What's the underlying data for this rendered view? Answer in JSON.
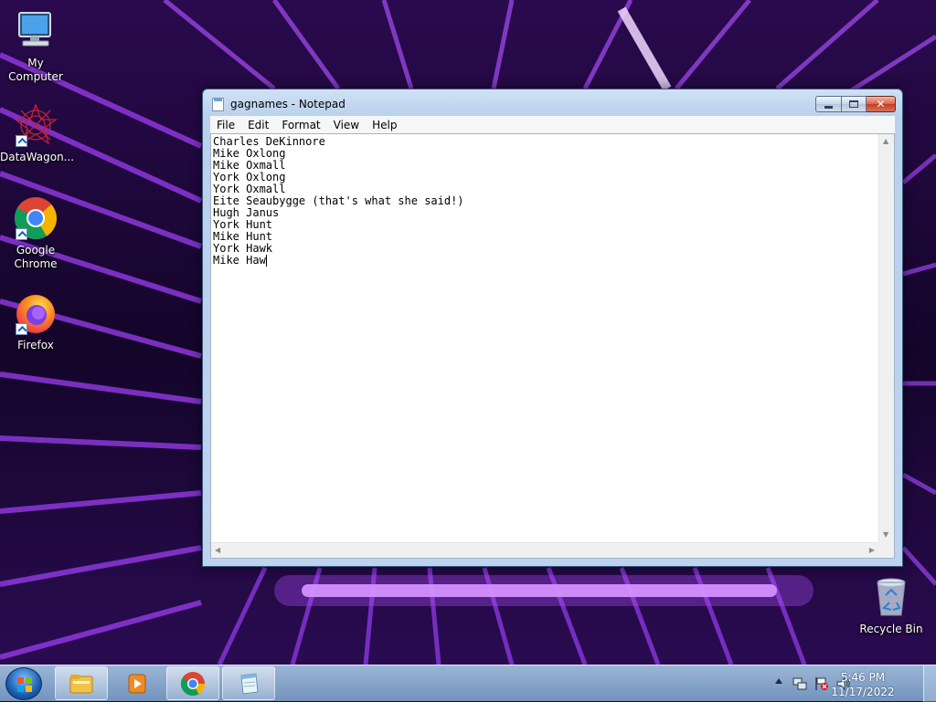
{
  "desktop": {
    "icons": [
      {
        "label": "My Computer"
      },
      {
        "label": "DataWagon..."
      },
      {
        "label": "Google Chrome"
      },
      {
        "label": "Firefox"
      },
      {
        "label": "Recycle Bin"
      }
    ]
  },
  "window": {
    "title": "gagnames - Notepad",
    "close_glyph": "✕",
    "menu": [
      "File",
      "Edit",
      "Format",
      "View",
      "Help"
    ],
    "lines": [
      "Charles DeKinnore",
      "Mike Oxlong",
      "Mike Oxmall",
      "York Oxlong",
      "York Oxmall",
      "Eite Seaubygge (that's what she said!)",
      "Hugh Janus",
      "York Hunt",
      "Mike Hunt",
      "York Hawk",
      "Mike Haw"
    ]
  },
  "taskbar": {
    "buttons": [
      "start",
      "file-explorer",
      "media-player",
      "chrome",
      "notepad"
    ],
    "clock": {
      "time": "5:46 PM",
      "date": "11/17/2022"
    }
  },
  "colors": {
    "wallpaper_base": "#1a0633",
    "wallpaper_glow": "#b14cff",
    "accent": "#1e5fb8"
  }
}
